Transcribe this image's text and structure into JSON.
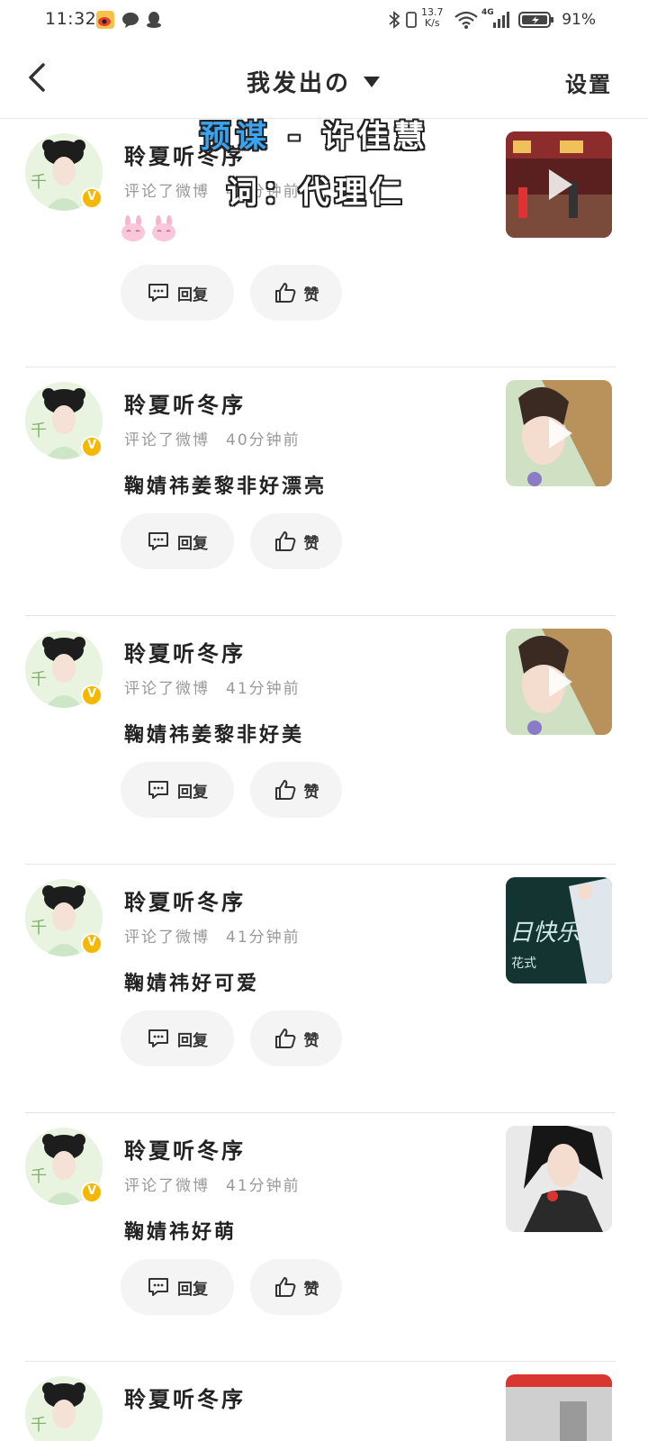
{
  "status_bar": {
    "time": "11:32",
    "net_speed_value": "13.7",
    "net_speed_unit": "K/s",
    "network": "4G",
    "battery": "91%"
  },
  "header": {
    "title": "我发出の",
    "settings": "设置"
  },
  "overlay": {
    "line1_a": "预谋",
    "line1_b": " - 许佳慧",
    "line2": "词：代理仁"
  },
  "actions": {
    "reply": "回复",
    "like": "赞"
  },
  "items": [
    {
      "username": "聆夏听冬序",
      "action": "评论了微博",
      "time": "40分钟前",
      "content": ""
    },
    {
      "username": "聆夏听冬序",
      "action": "评论了微博",
      "time": "40分钟前",
      "content": "鞠婧祎姜黎非好漂亮"
    },
    {
      "username": "聆夏听冬序",
      "action": "评论了微博",
      "time": "41分钟前",
      "content": "鞠婧祎姜黎非好美"
    },
    {
      "username": "聆夏听冬序",
      "action": "评论了微博",
      "time": "41分钟前",
      "content": "鞠婧祎好可爱"
    },
    {
      "username": "聆夏听冬序",
      "action": "评论了微博",
      "time": "41分钟前",
      "content": "鞠婧祎好萌"
    },
    {
      "username": "聆夏听冬序",
      "action": "",
      "time": "",
      "content": ""
    }
  ],
  "thumb_text": {
    "item4_a": "日快乐",
    "item4_b": "花式"
  },
  "colors": {
    "accent_badge": "#f5b700",
    "overlay_blue": "#3aa4f0"
  }
}
